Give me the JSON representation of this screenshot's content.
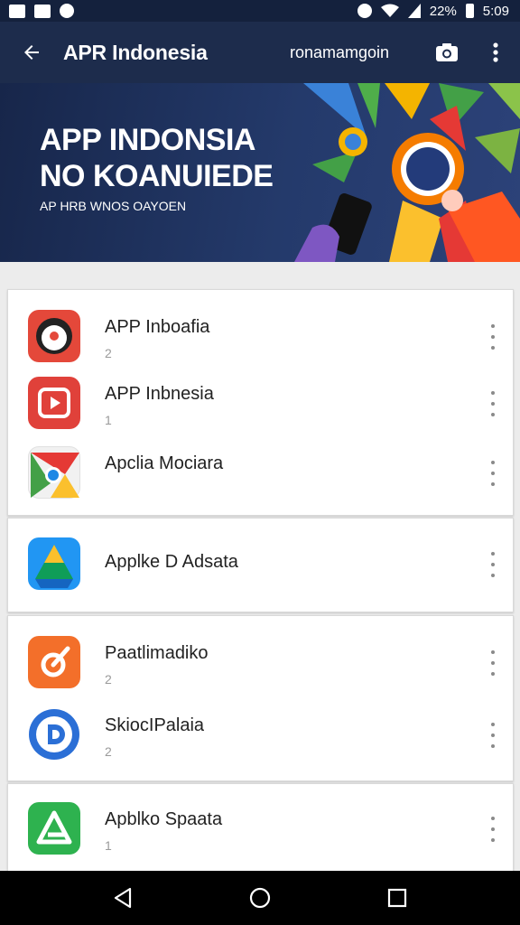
{
  "status_bar": {
    "battery": "22%",
    "time": "5:09",
    "icons": [
      "mail-icon",
      "image-icon",
      "shield-icon",
      "alarm-icon",
      "wifi-icon",
      "signal-icon",
      "battery-icon"
    ]
  },
  "app_bar": {
    "title": "APR Indonesia",
    "subtitle": "ronamamgoin",
    "icons": [
      "back-arrow-icon",
      "camera-icon",
      "more-vert-icon"
    ]
  },
  "banner": {
    "line1": "APP INDONSIA",
    "line2": "NO KOANUIEDE",
    "subline": "AP HRB WNOS OAYOEN"
  },
  "cards": [
    {
      "items": [
        {
          "title": "APP Inboafia",
          "count": "2",
          "icon": "red-app-icon",
          "color": "#e4483a"
        },
        {
          "title": "APP Inbnesia",
          "count": "1",
          "icon": "video-play-icon",
          "color": "#e0413a"
        },
        {
          "title": "Apclia Mociara",
          "count": "",
          "icon": "chrome-icon",
          "color": "#ffffff"
        }
      ]
    },
    {
      "items": [
        {
          "title": "Applke D Adsata",
          "count": "",
          "icon": "drive-icon",
          "color": "#2196f3"
        }
      ]
    },
    {
      "items": [
        {
          "title": "Paatlimadiko",
          "count": "2",
          "icon": "orange-app-icon",
          "color": "#f36f2a"
        },
        {
          "title": "SkiocIPalaia",
          "count": "2",
          "icon": "d-circle-icon",
          "color": "#2b6fd6"
        }
      ]
    },
    {
      "items": [
        {
          "title": "Apblko Spaata",
          "count": "1",
          "icon": "green-app-icon",
          "color": "#2eb24f"
        }
      ]
    }
  ],
  "nav_bar": {
    "icons": [
      "back-triangle-icon",
      "home-circle-icon",
      "recents-square-icon"
    ]
  }
}
